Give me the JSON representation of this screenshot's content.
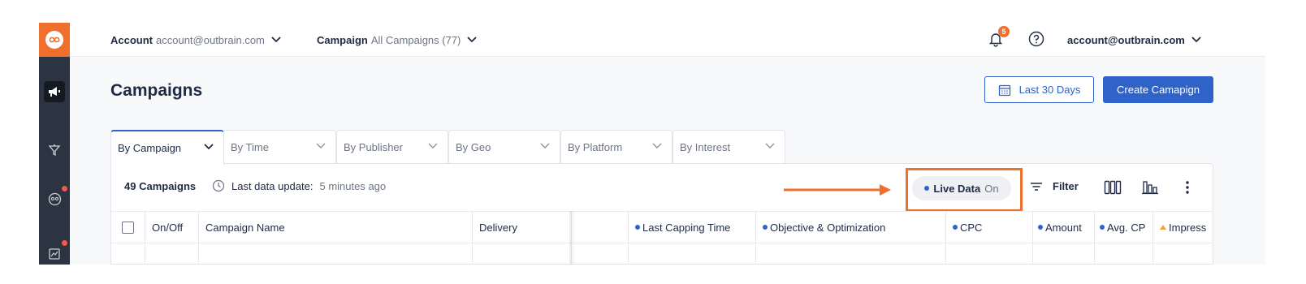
{
  "topbar": {
    "account_label": "Account",
    "account_value": "account@outbrain.com",
    "campaign_label": "Campaign",
    "campaign_value": "All Campaigns (77)",
    "notification_count": "5",
    "user": "account@outbrain.com"
  },
  "page": {
    "title": "Campaigns",
    "date_button": "Last 30 Days",
    "create_button": "Create Camapign"
  },
  "tabs": [
    {
      "label": "By Campaign"
    },
    {
      "label": "By Time"
    },
    {
      "label": "By Publisher"
    },
    {
      "label": "By Geo"
    },
    {
      "label": "By Platform"
    },
    {
      "label": "By Interest"
    }
  ],
  "toolbar": {
    "count": "49 Campaigns",
    "update_label": "Last data update:",
    "update_value": "5 minutes ago",
    "live_label": "Live Data",
    "live_state": "On",
    "filter": "Filter"
  },
  "table": {
    "columns": [
      {
        "label": "On/Off"
      },
      {
        "label": "Campaign Name"
      },
      {
        "label": "Delivery"
      },
      {
        "label": "Last Capping Time"
      },
      {
        "label": "Objective & Optimization"
      },
      {
        "label": "CPC"
      },
      {
        "label": "Amount"
      },
      {
        "label": "Avg. CP"
      },
      {
        "label": "Impress"
      }
    ]
  },
  "colors": {
    "brand": "#ef6f2e",
    "accent": "#2f63c9",
    "rail": "#2b3440",
    "alert_dot": "#f05a4f",
    "warning": "#f0a53b"
  },
  "icons": {
    "rail": [
      "outbrain-logo-icon",
      "megaphone-icon",
      "funnel-icon",
      "audience-icon",
      "reports-icon"
    ],
    "top": [
      "chevron-down-icon",
      "bell-icon",
      "help-icon"
    ],
    "toolbar": [
      "clock-icon",
      "arrow-right-icon",
      "filter-icon",
      "columns-icon",
      "chart-icon",
      "more-vertical-icon",
      "calendar-icon"
    ]
  }
}
